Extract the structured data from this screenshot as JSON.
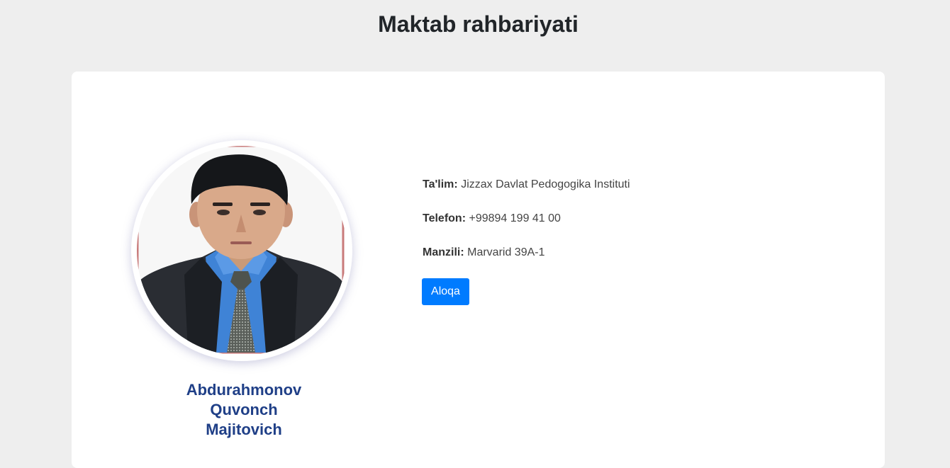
{
  "page": {
    "title": "Maktab rahbariyati"
  },
  "leader": {
    "name_line1": "Abdurahmonov",
    "name_line2": "Quvonch",
    "name_line3": "Majitovich",
    "education_label": "Ta'lim:",
    "education_value": "Jizzax Davlat Pedogogika Instituti",
    "phone_label": "Telefon:",
    "phone_value": "+99894 199 41 00",
    "address_label": "Manzili:",
    "address_value": "Marvarid 39A-1",
    "contact_button": "Aloqa"
  },
  "colors": {
    "background": "#eeeeee",
    "card": "#ffffff",
    "name": "#1f3f87",
    "button": "#007bff"
  }
}
